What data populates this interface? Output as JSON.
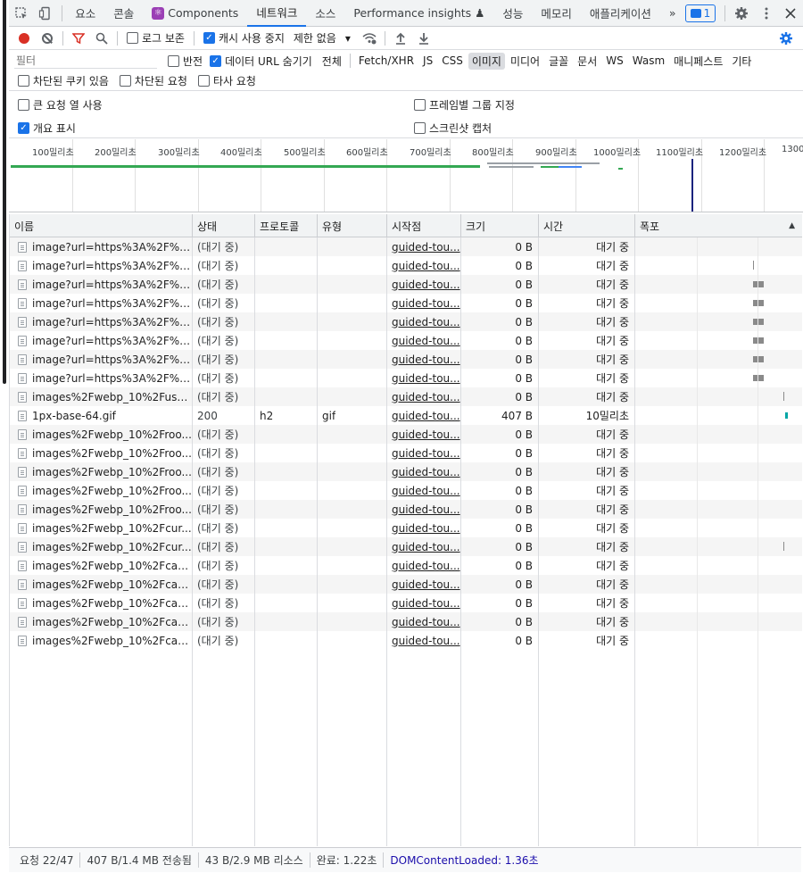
{
  "tabs": [
    {
      "label": "요소",
      "active": false
    },
    {
      "label": "콘솔",
      "active": false
    },
    {
      "label": "Components",
      "active": false
    },
    {
      "label": "네트워크",
      "active": true
    },
    {
      "label": "소스",
      "active": false
    },
    {
      "label": "Performance insights ♟",
      "active": false
    },
    {
      "label": "성능",
      "active": false
    },
    {
      "label": "메모리",
      "active": false
    },
    {
      "label": "애플리케이션",
      "active": false
    }
  ],
  "more_tabs": "»",
  "issues_count": "1",
  "toolbar": {
    "preserve_log": "로그 보존",
    "disable_cache": "캐시 사용 중지",
    "throttle": "제한 없음"
  },
  "filter": {
    "placeholder": "필터",
    "invert": "반전",
    "hide_data_urls": "데이터 URL 숨기기",
    "types": [
      "전체",
      "Fetch/XHR",
      "JS",
      "CSS",
      "이미지",
      "미디어",
      "글꼴",
      "문서",
      "WS",
      "Wasm",
      "매니페스트",
      "기타"
    ],
    "active_type": "이미지",
    "blocked_cookies": "차단된 쿠키 있음",
    "blocked_requests": "차단된 요청",
    "third_party": "타사 요청"
  },
  "settings": {
    "big_rows": "큰 요청 열 사용",
    "group_by_frame": "프레임별 그룹 지정",
    "show_overview": "개요 표시",
    "capture_screenshots": "스크린샷 캡처"
  },
  "overview_ticks": [
    "100밀리초",
    "200밀리초",
    "300밀리초",
    "400밀리초",
    "500밀리초",
    "600밀리초",
    "700밀리초",
    "800밀리초",
    "900밀리초",
    "1000밀리초",
    "1100밀리초",
    "1200밀리초",
    "1300"
  ],
  "columns": {
    "name": "이름",
    "status": "상태",
    "protocol": "프로토콜",
    "type": "유형",
    "initiator": "시작점",
    "size": "크기",
    "time": "시간",
    "waterfall": "폭포"
  },
  "rows": [
    {
      "name": "image?url=https%3A%2F%2...",
      "status": "(대기 중)",
      "protocol": "",
      "type": "",
      "initiator": "guided-tou...",
      "size": "0 B",
      "time": "대기 중"
    },
    {
      "name": "image?url=https%3A%2F%2...",
      "status": "(대기 중)",
      "protocol": "",
      "type": "",
      "initiator": "guided-tou...",
      "size": "0 B",
      "time": "대기 중"
    },
    {
      "name": "image?url=https%3A%2F%2...",
      "status": "(대기 중)",
      "protocol": "",
      "type": "",
      "initiator": "guided-tou...",
      "size": "0 B",
      "time": "대기 중"
    },
    {
      "name": "image?url=https%3A%2F%2...",
      "status": "(대기 중)",
      "protocol": "",
      "type": "",
      "initiator": "guided-tou...",
      "size": "0 B",
      "time": "대기 중"
    },
    {
      "name": "image?url=https%3A%2F%2...",
      "status": "(대기 중)",
      "protocol": "",
      "type": "",
      "initiator": "guided-tou...",
      "size": "0 B",
      "time": "대기 중"
    },
    {
      "name": "image?url=https%3A%2F%2...",
      "status": "(대기 중)",
      "protocol": "",
      "type": "",
      "initiator": "guided-tou...",
      "size": "0 B",
      "time": "대기 중"
    },
    {
      "name": "image?url=https%3A%2F%2...",
      "status": "(대기 중)",
      "protocol": "",
      "type": "",
      "initiator": "guided-tou...",
      "size": "0 B",
      "time": "대기 중"
    },
    {
      "name": "image?url=https%3A%2F%2...",
      "status": "(대기 중)",
      "protocol": "",
      "type": "",
      "initiator": "guided-tou...",
      "size": "0 B",
      "time": "대기 중"
    },
    {
      "name": "images%2Fwebp_10%2Fuser...",
      "status": "(대기 중)",
      "protocol": "",
      "type": "",
      "initiator": "guided-tou...",
      "size": "0 B",
      "time": "대기 중"
    },
    {
      "name": "1px-base-64.gif",
      "status": "200",
      "protocol": "h2",
      "type": "gif",
      "initiator": "guided-tou...",
      "size": "407 B",
      "time": "10밀리초"
    },
    {
      "name": "images%2Fwebp_10%2Froo...",
      "status": "(대기 중)",
      "protocol": "",
      "type": "",
      "initiator": "guided-tou...",
      "size": "0 B",
      "time": "대기 중"
    },
    {
      "name": "images%2Fwebp_10%2Froo...",
      "status": "(대기 중)",
      "protocol": "",
      "type": "",
      "initiator": "guided-tou...",
      "size": "0 B",
      "time": "대기 중"
    },
    {
      "name": "images%2Fwebp_10%2Froo...",
      "status": "(대기 중)",
      "protocol": "",
      "type": "",
      "initiator": "guided-tou...",
      "size": "0 B",
      "time": "대기 중"
    },
    {
      "name": "images%2Fwebp_10%2Froo...",
      "status": "(대기 중)",
      "protocol": "",
      "type": "",
      "initiator": "guided-tou...",
      "size": "0 B",
      "time": "대기 중"
    },
    {
      "name": "images%2Fwebp_10%2Froo...",
      "status": "(대기 중)",
      "protocol": "",
      "type": "",
      "initiator": "guided-tou...",
      "size": "0 B",
      "time": "대기 중"
    },
    {
      "name": "images%2Fwebp_10%2Fcur...",
      "status": "(대기 중)",
      "protocol": "",
      "type": "",
      "initiator": "guided-tou...",
      "size": "0 B",
      "time": "대기 중"
    },
    {
      "name": "images%2Fwebp_10%2Fcur...",
      "status": "(대기 중)",
      "protocol": "",
      "type": "",
      "initiator": "guided-tou...",
      "size": "0 B",
      "time": "대기 중"
    },
    {
      "name": "images%2Fwebp_10%2Fcate...",
      "status": "(대기 중)",
      "protocol": "",
      "type": "",
      "initiator": "guided-tou...",
      "size": "0 B",
      "time": "대기 중"
    },
    {
      "name": "images%2Fwebp_10%2Fcate...",
      "status": "(대기 중)",
      "protocol": "",
      "type": "",
      "initiator": "guided-tou...",
      "size": "0 B",
      "time": "대기 중"
    },
    {
      "name": "images%2Fwebp_10%2Fcate...",
      "status": "(대기 중)",
      "protocol": "",
      "type": "",
      "initiator": "guided-tou...",
      "size": "0 B",
      "time": "대기 중"
    },
    {
      "name": "images%2Fwebp_10%2Fcate...",
      "status": "(대기 중)",
      "protocol": "",
      "type": "",
      "initiator": "guided-tou...",
      "size": "0 B",
      "time": "대기 중"
    },
    {
      "name": "images%2Fwebp_10%2Fcate...",
      "status": "(대기 중)",
      "protocol": "",
      "type": "",
      "initiator": "guided-tou...",
      "size": "0 B",
      "time": "대기 중"
    }
  ],
  "statusbar": {
    "requests": "요청 22/47",
    "transferred": "407 B/1.4 MB 전송됨",
    "resources": "43 B/2.9 MB 리소스",
    "finish": "완료: 1.22초",
    "dom_loaded": "DOMContentLoaded: 1.36초"
  },
  "colors": {
    "accent": "#1a73e8",
    "record": "#d93025",
    "overview_green": "#34a853"
  }
}
